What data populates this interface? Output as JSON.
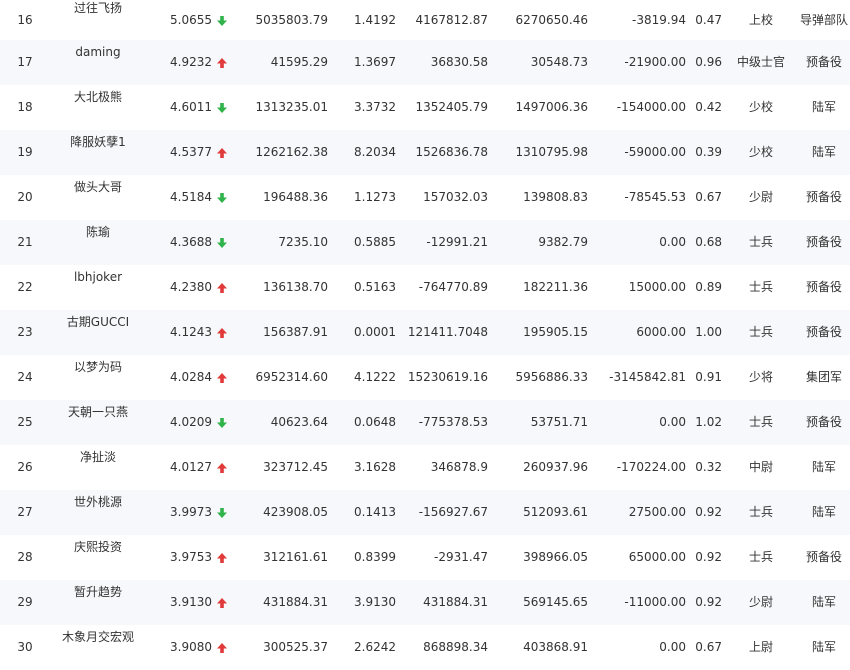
{
  "table": {
    "rows": [
      {
        "rank": "16",
        "name": "过往飞扬",
        "score": "5.0655",
        "dir": "down",
        "v1": "5035803.79",
        "v2": "1.4192",
        "v3": "4167812.87",
        "v4": "6270650.46",
        "v5": "-3819.94",
        "v6": "0.47",
        "title": "上校",
        "unit": "导弹部队"
      },
      {
        "rank": "17",
        "name": "daming",
        "score": "4.9232",
        "dir": "up",
        "v1": "41595.29",
        "v2": "1.3697",
        "v3": "36830.58",
        "v4": "30548.73",
        "v5": "-21900.00",
        "v6": "0.96",
        "title": "中级士官",
        "unit": "预备役"
      },
      {
        "rank": "18",
        "name": "大北极熊",
        "score": "4.6011",
        "dir": "down",
        "v1": "1313235.01",
        "v2": "3.3732",
        "v3": "1352405.79",
        "v4": "1497006.36",
        "v5": "-154000.00",
        "v6": "0.42",
        "title": "少校",
        "unit": "陆军"
      },
      {
        "rank": "19",
        "name": "降服妖孽1",
        "score": "4.5377",
        "dir": "up",
        "v1": "1262162.38",
        "v2": "8.2034",
        "v3": "1526836.78",
        "v4": "1310795.98",
        "v5": "-59000.00",
        "v6": "0.39",
        "title": "少校",
        "unit": "陆军"
      },
      {
        "rank": "20",
        "name": "做头大哥",
        "score": "4.5184",
        "dir": "down",
        "v1": "196488.36",
        "v2": "1.1273",
        "v3": "157032.03",
        "v4": "139808.83",
        "v5": "-78545.53",
        "v6": "0.67",
        "title": "少尉",
        "unit": "预备役"
      },
      {
        "rank": "21",
        "name": "陈瑜",
        "score": "4.3688",
        "dir": "down",
        "v1": "7235.10",
        "v2": "0.5885",
        "v3": "-12991.21",
        "v4": "9382.79",
        "v5": "0.00",
        "v6": "0.68",
        "title": "士兵",
        "unit": "预备役"
      },
      {
        "rank": "22",
        "name": "lbhjoker",
        "score": "4.2380",
        "dir": "up",
        "v1": "136138.70",
        "v2": "0.5163",
        "v3": "-764770.89",
        "v4": "182211.36",
        "v5": "15000.00",
        "v6": "0.89",
        "title": "士兵",
        "unit": "预备役"
      },
      {
        "rank": "23",
        "name": "古期GUCCI",
        "score": "4.1243",
        "dir": "up",
        "v1": "156387.91",
        "v2": "0.0001",
        "v3": "121411.7048",
        "v4": "195905.15",
        "v5": "6000.00",
        "v6": "1.00",
        "title": "士兵",
        "unit": "预备役"
      },
      {
        "rank": "24",
        "name": "以梦为码",
        "score": "4.0284",
        "dir": "up",
        "v1": "6952314.60",
        "v2": "4.1222",
        "v3": "15230619.16",
        "v4": "5956886.33",
        "v5": "-3145842.81",
        "v6": "0.91",
        "title": "少将",
        "unit": "集团军"
      },
      {
        "rank": "25",
        "name": "天朝一只燕",
        "score": "4.0209",
        "dir": "down",
        "v1": "40623.64",
        "v2": "0.0648",
        "v3": "-775378.53",
        "v4": "53751.71",
        "v5": "0.00",
        "v6": "1.02",
        "title": "士兵",
        "unit": "预备役"
      },
      {
        "rank": "26",
        "name": "净扯淡",
        "score": "4.0127",
        "dir": "up",
        "v1": "323712.45",
        "v2": "3.1628",
        "v3": "346878.9",
        "v4": "260937.96",
        "v5": "-170224.00",
        "v6": "0.32",
        "title": "中尉",
        "unit": "陆军"
      },
      {
        "rank": "27",
        "name": "世外桃源",
        "score": "3.9973",
        "dir": "down",
        "v1": "423908.05",
        "v2": "0.1413",
        "v3": "-156927.67",
        "v4": "512093.61",
        "v5": "27500.00",
        "v6": "0.92",
        "title": "士兵",
        "unit": "陆军"
      },
      {
        "rank": "28",
        "name": "庆熙投资",
        "score": "3.9753",
        "dir": "up",
        "v1": "312161.61",
        "v2": "0.8399",
        "v3": "-2931.47",
        "v4": "398966.05",
        "v5": "65000.00",
        "v6": "0.92",
        "title": "士兵",
        "unit": "预备役"
      },
      {
        "rank": "29",
        "name": "暂升趋势",
        "score": "3.9130",
        "dir": "up",
        "v1": "431884.31",
        "v2": "3.9130",
        "v3": "431884.31",
        "v4": "569145.65",
        "v5": "-11000.00",
        "v6": "0.92",
        "title": "少尉",
        "unit": "陆军"
      },
      {
        "rank": "30",
        "name": "木象月交宏观",
        "score": "3.9080",
        "dir": "up",
        "v1": "300525.37",
        "v2": "2.6242",
        "v3": "868898.34",
        "v4": "403868.91",
        "v5": "0.00",
        "v6": "0.67",
        "title": "上尉",
        "unit": "陆军"
      }
    ]
  },
  "colors": {
    "up": "#e03a3a",
    "down": "#2fb34a",
    "alt_row": "#f7f8fb"
  },
  "icons": {
    "up": "arrow-up-icon",
    "down": "arrow-down-icon"
  }
}
